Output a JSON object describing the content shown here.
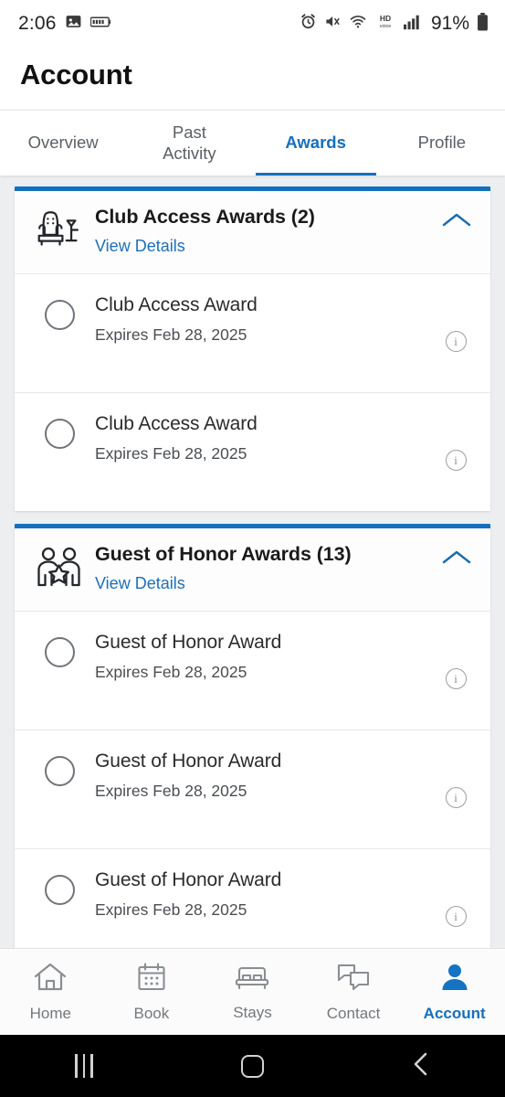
{
  "status_bar": {
    "time": "2:06",
    "battery_percent": "91%",
    "left_icons": [
      "image-icon",
      "battery-saver-icon"
    ],
    "right_icons": [
      "alarm-icon",
      "mute-icon",
      "wifi-icon",
      "hd-voice-icon",
      "signal-icon",
      "battery-icon"
    ],
    "hd_top": "HD",
    "hd_bottom": "voice"
  },
  "header": {
    "title": "Account"
  },
  "tabs": [
    {
      "label": "Overview",
      "active": false
    },
    {
      "label": "Past\nActivity",
      "active": false,
      "line1": "Past",
      "line2": "Activity"
    },
    {
      "label": "Awards",
      "active": true
    },
    {
      "label": "Profile",
      "active": false
    }
  ],
  "colors": {
    "accent_blue": "#1470bd",
    "link_blue": "#1d6fb8",
    "page_bg": "#eceef0",
    "card_bg": "#ffffff"
  },
  "award_groups": [
    {
      "icon": "armchair-lounge-icon",
      "title": "Club Access Awards (2)",
      "link": "View Details",
      "collapse_icon": "chevron-up-icon",
      "expanded": true,
      "items": [
        {
          "title": "Club Access Award",
          "expiry": "Expires Feb 28, 2025",
          "selected": false,
          "info_icon": "info-icon"
        },
        {
          "title": "Club Access Award",
          "expiry": "Expires Feb 28, 2025",
          "selected": false,
          "info_icon": "info-icon"
        }
      ]
    },
    {
      "icon": "guest-of-honor-people-star-icon",
      "title": "Guest of Honor Awards (13)",
      "link": "View Details",
      "collapse_icon": "chevron-up-icon",
      "expanded": true,
      "items": [
        {
          "title": "Guest of Honor Award",
          "expiry": "Expires Feb 28, 2025",
          "selected": false,
          "info_icon": "info-icon"
        },
        {
          "title": "Guest of Honor Award",
          "expiry": "Expires Feb 28, 2025",
          "selected": false,
          "info_icon": "info-icon"
        },
        {
          "title": "Guest of Honor Award",
          "expiry": "Expires Feb 28, 2025",
          "selected": false,
          "info_icon": "info-icon"
        }
      ]
    }
  ],
  "bottom_nav": [
    {
      "label": "Home",
      "icon": "home-icon",
      "active": false
    },
    {
      "label": "Book",
      "icon": "calendar-icon",
      "active": false
    },
    {
      "label": "Stays",
      "icon": "bed-icon",
      "active": false
    },
    {
      "label": "Contact",
      "icon": "chat-bubbles-icon",
      "active": false
    },
    {
      "label": "Account",
      "icon": "person-icon",
      "active": true
    }
  ],
  "android_nav": [
    "recents-icon",
    "home-icon",
    "back-icon"
  ]
}
